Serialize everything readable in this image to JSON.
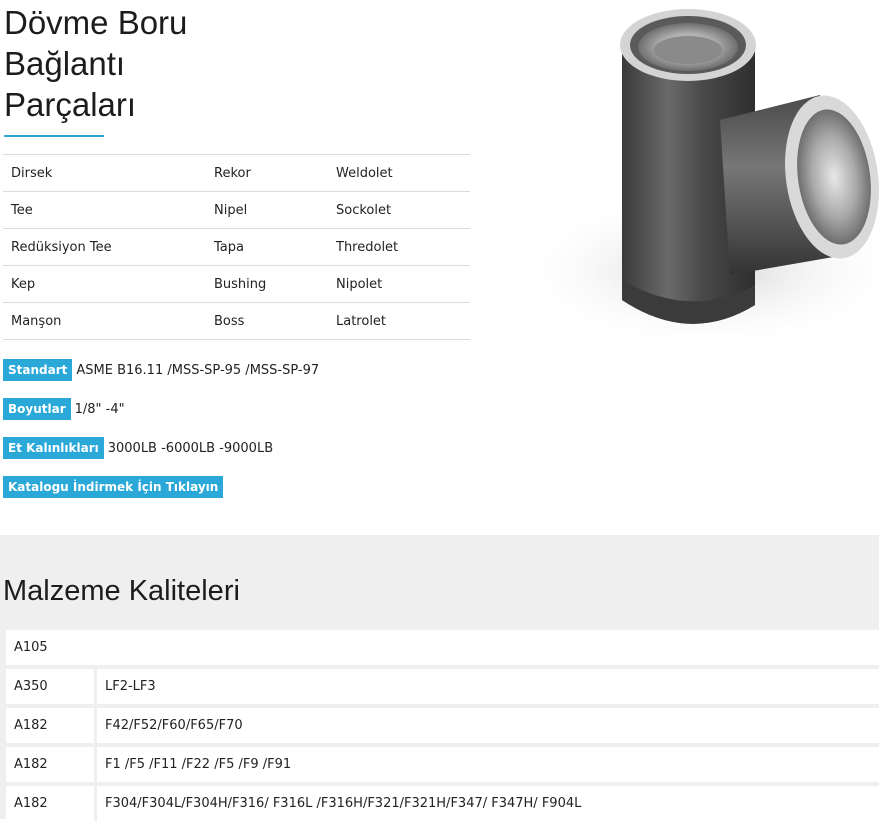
{
  "header": {
    "title_lines": [
      "Dövme Boru",
      "Bağlantı",
      "Parçaları"
    ],
    "accent_color": "#2aa8d8"
  },
  "fittings": [
    [
      "Dirsek",
      "Rekor",
      "Weldolet"
    ],
    [
      "Tee",
      "Nipel",
      "Sockolet"
    ],
    [
      "Redüksiyon Tee",
      "Tapa",
      "Thredolet"
    ],
    [
      "Kep",
      "Bushing",
      "Nipolet"
    ],
    [
      "Manşon",
      "Boss",
      "Latrolet"
    ]
  ],
  "specs": {
    "standart": {
      "label": "Standart",
      "value": "ASME B16.11 /MSS-SP-95 /MSS-SP-97"
    },
    "boyutlar": {
      "label": "Boyutlar",
      "value": "1/8\" -4\""
    },
    "et": {
      "label": "Et Kalınlıkları",
      "value": "3000LB -6000LB -9000LB"
    },
    "catalog_button": "Katalogu İndirmek İçin Tıklayın"
  },
  "materials": {
    "title": "Malzeme Kaliteleri",
    "rows": [
      {
        "grade": "A105",
        "values": ""
      },
      {
        "grade": "A350",
        "values": "LF2-LF3"
      },
      {
        "grade": "A182",
        "values": "F42/F52/F60/F65/F70"
      },
      {
        "grade": "A182",
        "values": "F1 /F5 /F11 /F22 /F5 /F9 /F91"
      },
      {
        "grade": "A182",
        "values": "F304/F304L/F304H/F316/ F316L /F316H/F321/F321H/F347/ F347H/ F904L"
      }
    ]
  },
  "image": {
    "icon": "forged-tee-fitting-image"
  }
}
